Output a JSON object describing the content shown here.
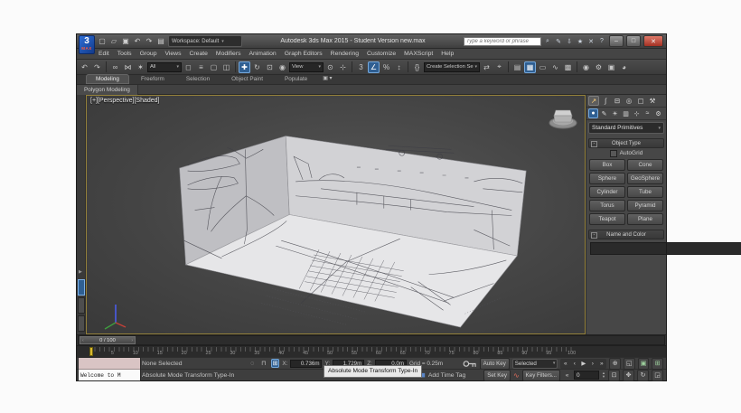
{
  "window": {
    "title": "Autodesk 3ds Max 2015  - Student Version   new.max",
    "workspace": "Workspace: Default",
    "search_placeholder": "Type a keyword or phrase",
    "minimize": "–",
    "maximize": "□",
    "close": "✕"
  },
  "quick_access": [
    {
      "name": "new-scene-icon",
      "glyph": "▢"
    },
    {
      "name": "open-file-icon",
      "glyph": "▱"
    },
    {
      "name": "save-file-icon",
      "glyph": "▣"
    },
    {
      "name": "undo-icon",
      "glyph": "↶"
    },
    {
      "name": "redo-icon",
      "glyph": "↷"
    },
    {
      "name": "project-folder-icon",
      "glyph": "▤"
    }
  ],
  "title_icons": [
    {
      "name": "search-icon",
      "glyph": "⌕"
    },
    {
      "name": "sign-in-icon",
      "glyph": "✎"
    },
    {
      "name": "updates-icon",
      "glyph": "⇩"
    },
    {
      "name": "favorites-icon",
      "glyph": "★"
    },
    {
      "name": "exchange-icon",
      "glyph": "✕"
    },
    {
      "name": "help-icon",
      "glyph": "?"
    }
  ],
  "menu": {
    "items": [
      "Edit",
      "Tools",
      "Group",
      "Views",
      "Create",
      "Modifiers",
      "Animation",
      "Graph Editors",
      "Rendering",
      "Customize",
      "MAXScript",
      "Help"
    ]
  },
  "toolbar": {
    "undo_redo": [
      {
        "name": "undo-icon",
        "glyph": "↶"
      },
      {
        "name": "redo-icon",
        "glyph": "↷"
      }
    ],
    "link_group": [
      {
        "name": "select-link-icon",
        "glyph": "∞"
      },
      {
        "name": "unlink-icon",
        "glyph": "⋈"
      },
      {
        "name": "bind-spacewarp-icon",
        "glyph": "✶"
      }
    ],
    "selection_filter": "All",
    "select_group": [
      {
        "name": "select-object-icon",
        "glyph": "◻"
      },
      {
        "name": "select-by-name-icon",
        "glyph": "≡"
      },
      {
        "name": "rect-region-icon",
        "glyph": "▢"
      },
      {
        "name": "window-crossing-icon",
        "glyph": "◫"
      }
    ],
    "transform_group": [
      {
        "name": "select-move-icon",
        "glyph": "✚",
        "active": true
      },
      {
        "name": "select-rotate-icon",
        "glyph": "↻"
      },
      {
        "name": "select-scale-icon",
        "glyph": "⊡"
      },
      {
        "name": "select-place-icon",
        "glyph": "◉"
      }
    ],
    "coord_system": "View",
    "pivot_group": [
      {
        "name": "use-pivot-center-icon",
        "glyph": "⊙"
      },
      {
        "name": "select-manipulate-icon",
        "glyph": "⊹"
      }
    ],
    "snap_group": [
      {
        "name": "snap-toggle-3d-icon",
        "glyph": "3"
      },
      {
        "name": "angle-snap-icon",
        "glyph": "∠",
        "active": true
      },
      {
        "name": "percent-snap-icon",
        "glyph": "%"
      },
      {
        "name": "spinner-snap-icon",
        "glyph": "↕"
      }
    ],
    "named_sets_icon": [
      {
        "name": "edit-named-sets-icon",
        "glyph": "{}"
      }
    ],
    "named_sets": "Create Selection Se",
    "mirror_align": [
      {
        "name": "mirror-icon",
        "glyph": "⇄"
      },
      {
        "name": "align-icon",
        "glyph": "⌖"
      }
    ],
    "explorer_group": [
      {
        "name": "scene-explorer-icon",
        "glyph": "▤"
      },
      {
        "name": "layer-explorer-icon",
        "glyph": "▦",
        "active": true
      },
      {
        "name": "ribbon-toggle-icon",
        "glyph": "▭"
      },
      {
        "name": "curve-editor-icon",
        "glyph": "∿"
      },
      {
        "name": "schematic-view-icon",
        "glyph": "▩"
      }
    ],
    "render_group": [
      {
        "name": "material-editor-icon",
        "glyph": "◉"
      },
      {
        "name": "render-setup-icon",
        "glyph": "⚙"
      },
      {
        "name": "rendered-frame-icon",
        "glyph": "▣"
      },
      {
        "name": "render-production-icon",
        "glyph": "◕"
      }
    ]
  },
  "ribbon": {
    "tabs": [
      {
        "label": "Modeling",
        "active": true
      },
      {
        "label": "Freeform"
      },
      {
        "label": "Selection"
      },
      {
        "label": "Object Paint"
      },
      {
        "label": "Populate"
      }
    ],
    "panel": "Polygon Modeling"
  },
  "viewport": {
    "label_plus": "[+]",
    "label_view": "[Perspective]",
    "label_shading": "[Shaded]"
  },
  "command_panel": {
    "tabs": [
      {
        "name": "tab-create",
        "glyph": "↗",
        "active": true
      },
      {
        "name": "tab-modify",
        "glyph": "∫"
      },
      {
        "name": "tab-hierarchy",
        "glyph": "⊟"
      },
      {
        "name": "tab-motion",
        "glyph": "◎"
      },
      {
        "name": "tab-display",
        "glyph": "▢"
      },
      {
        "name": "tab-utilities",
        "glyph": "⚒"
      }
    ],
    "subtabs": [
      {
        "name": "subtab-geometry",
        "glyph": "●",
        "active": true
      },
      {
        "name": "subtab-shapes",
        "glyph": "✎"
      },
      {
        "name": "subtab-lights",
        "glyph": "☀"
      },
      {
        "name": "subtab-cameras",
        "glyph": "▥"
      },
      {
        "name": "subtab-helpers",
        "glyph": "⊹"
      },
      {
        "name": "subtab-spacewarps",
        "glyph": "≈"
      },
      {
        "name": "subtab-systems",
        "glyph": "⚙"
      }
    ],
    "category": "Standard Primitives",
    "object_type": {
      "title": "Object Type",
      "autogrid": "AutoGrid",
      "buttons": [
        "Box",
        "Cone",
        "Sphere",
        "GeoSphere",
        "Cylinder",
        "Tube",
        "Torus",
        "Pyramid",
        "Teapot",
        "Plane"
      ]
    },
    "name_color": {
      "title": "Name and Color"
    }
  },
  "time_slider": {
    "value": "0 / 100"
  },
  "trackbar": {
    "labels": [
      "5",
      "10",
      "15",
      "20",
      "25",
      "30",
      "35",
      "40",
      "45",
      "50",
      "55",
      "60",
      "65",
      "70",
      "75",
      "80",
      "85",
      "90",
      "95",
      "100"
    ]
  },
  "status_bar": {
    "selection": "None Selected",
    "listener_text": "Welcome to M",
    "x_label": "X:",
    "x_value": "0.736m",
    "y_label": "Y:",
    "y_value": "1.729m",
    "z_label": "Z:",
    "z_value": "0.0m",
    "grid": "Grid = 0.25m",
    "prompt": "Absolute Mode Transform Type-In",
    "tooltip": "Absolute Mode Transform Type-In",
    "add_time_tag": "Add Time Tag",
    "auto_key": "Auto Key",
    "key_mode": "Selected",
    "set_key": "Set Key",
    "key_filters": "Key Filters...",
    "frame": "0"
  },
  "colors": {
    "accent_blue": "#2f5f92",
    "active_border_yellow": "#93803a",
    "close_red": "#a33023",
    "marker_yellow": "#d9ba2f",
    "swatch_blue": "#3c50da"
  }
}
